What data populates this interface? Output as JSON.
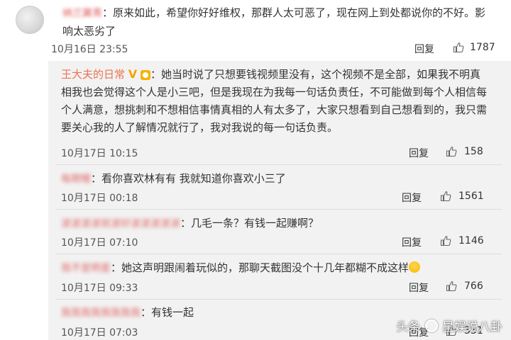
{
  "top_comment": {
    "author": "纳兰冀青",
    "text": "：原来如此，希望你好好维权，那群人太可恶了，现在网上到处都说你的不好。影响太恶劣了",
    "date": "10月16日 23:55",
    "reply_label": "回复",
    "likes": "1787"
  },
  "replies": [
    {
      "author": "王大夫的日常",
      "text": "：她当时说了只想要钱视频里没有，这个视频不是全部，如果我不明真相我也会觉得这个人是小三吧，但是我现在为我每一句话负责任，不可能做到每个人相信每个人满意，想挑刺和不想相信事情真相的人有太多了，大家只想看到自己想看到的，我只需要关心我的人了解情况就行了，我对我说的每一句话负责。",
      "date": "10月17日 10:15",
      "reply_label": "回复",
      "likes": "158"
    },
    {
      "author": "每期喔",
      "text": "：看你喜欢林有有 我就知道你喜欢小三了",
      "date": "10月17日 00:18",
      "reply_label": "回复",
      "likes": "1561"
    },
    {
      "author": "波波波波就波好波波波波波",
      "text": "：几毛一条？有钱一起赚啊？",
      "date": "10月17日 07:10",
      "reply_label": "回复",
      "likes": "1146"
    },
    {
      "author": "我不是明星",
      "text": "：她这声明跟闹着玩似的，那聊天截图没个十几年都糊不成这样",
      "date": "10月17日 09:33",
      "reply_label": "回复",
      "likes": "766"
    },
    {
      "author": "我我我我我我我我",
      "text": "：有钱一起",
      "date": "10月17日 07:03",
      "reply_label": "回复",
      "likes": "331"
    }
  ],
  "watermark": {
    "prefix": "头条",
    "handle": "星娱说八卦"
  }
}
